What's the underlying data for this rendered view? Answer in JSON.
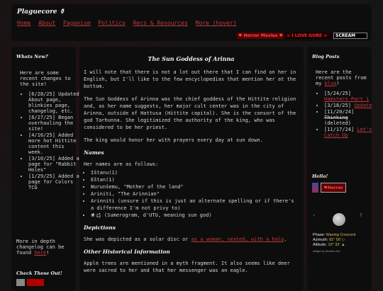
{
  "site": {
    "title": "Plaguecore",
    "nav": [
      "Home",
      "About",
      "Paganism",
      "Politics",
      "Recs & Resources",
      "More (hover)"
    ],
    "banners": [
      "♥ Horror Movies ♥",
      "☠ I LOVE GORE ☠",
      "SCREAM"
    ]
  },
  "left": {
    "whats_new_title": "Whats New?",
    "intro": "Here are some recent changes to the site!",
    "changes": [
      {
        "date": "[6/28/25]",
        "text": "Updated About page, blinkies page, changelog, etc."
      },
      {
        "date": "[6/27/25]",
        "text": "Began overhauling the site!"
      },
      {
        "date": "[4/16/25]",
        "text": "Added more hot Hittite content this week."
      },
      {
        "date": "[3/10/25]",
        "text": "Added a page for \"Rabbit Holes\""
      },
      {
        "date": "[1/29/25]",
        "text": "Added a page for Colors TCG"
      }
    ],
    "more_prefix": "More in depth changelog can be found",
    "more_link": "here",
    "more_suffix": "!",
    "check_title": "Check These Out!"
  },
  "main": {
    "title": "The Sun Goddess of Arinna",
    "p1": "I will note that there is not a lot out there that I can find on her in English, but I'll like to the few encyclopedias that mention her at the bottom.",
    "p2": "The Sun Goddess of Arinna was the chief goddess of the Hittite religion and, as her name suggests, her major cult center was in the city of Arinna, outside of Hattusa (Hittite capital). She is the consort of the god Tarhunna. She legitimized the authority of the king, who was considered to be her priest.",
    "p3": "The king would honor her with prayers every day at sun down.",
    "names_heading": "Names",
    "names_intro": "Her names are as follows:",
    "names": [
      "Ištanu(1)",
      "Eštan(1)",
      "Wurunšemu, \"Mother of the land\"",
      "Ariniti, \"The Arinnian\"",
      "Arinniti (unsure if this is just an alternate spelling or if there's a difference I'm not privy to)",
      "𒀭𒌓 (Sumerogram, d'UTU, meaning sun god)"
    ],
    "depictions_heading": "Depictions",
    "depictions_prefix": "She was depicted as a solar disc or",
    "depictions_link": "as a woman, seated, with a halo",
    "depictions_suffix": ".",
    "other_heading": "Other Historical Information",
    "p4": "Apple trees are mentioned in a myth fragment. It also seems like deer were sacred to her and that her messenger was an eagle."
  },
  "right": {
    "blog_title": "Blog Posts",
    "intro_prefix": "Here are the recent posts from my",
    "intro_link": "blog",
    "intro_suffix": "!",
    "posts": [
      {
        "date": "[5/24/25]",
        "link": "Hamsters Part 1",
        "note": ""
      },
      {
        "date": "[3/18/25]",
        "link": "Update",
        "note": ""
      },
      {
        "date": "[11/20/24]",
        "strike": "Thinking",
        "note": "(deleted)"
      },
      {
        "date": "[11/17/24]",
        "link": "Let's Catch Up",
        "note": ""
      }
    ],
    "hello_title": "Hello!",
    "hello_badge": "♥Horror",
    "moon": {
      "phase_label": "Phase:",
      "phase_value": "Waxing Crescent",
      "azimuth_label": "Azimuth:",
      "azimuth_value": "81° 56' ▷",
      "altitude_label": "Altitude:",
      "altitude_value": "10° 33' ▲",
      "widget": "widget by dimden.dev"
    }
  },
  "colors": {
    "accent": "#c43a3a",
    "panel": "#0d0d0d",
    "background": "#151515"
  }
}
